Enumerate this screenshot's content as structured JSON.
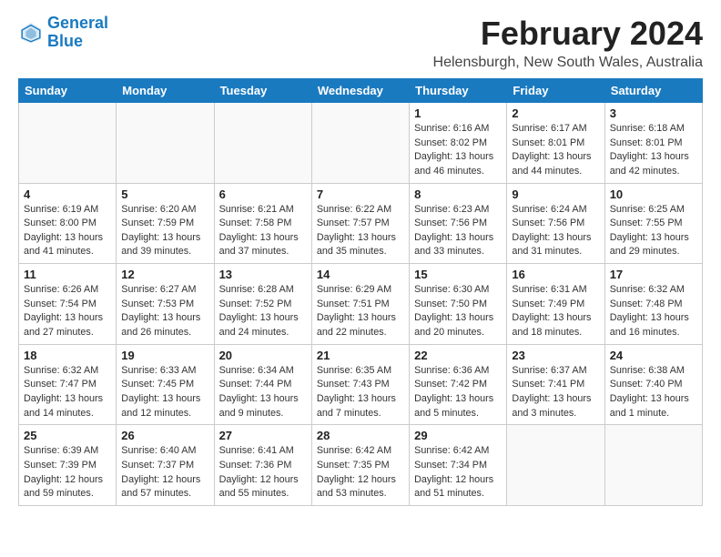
{
  "logo": {
    "text_general": "General",
    "text_blue": "Blue"
  },
  "title": "February 2024",
  "subtitle": "Helensburgh, New South Wales, Australia",
  "days_of_week": [
    "Sunday",
    "Monday",
    "Tuesday",
    "Wednesday",
    "Thursday",
    "Friday",
    "Saturday"
  ],
  "weeks": [
    [
      {
        "day": "",
        "info": ""
      },
      {
        "day": "",
        "info": ""
      },
      {
        "day": "",
        "info": ""
      },
      {
        "day": "",
        "info": ""
      },
      {
        "day": "1",
        "info": "Sunrise: 6:16 AM\nSunset: 8:02 PM\nDaylight: 13 hours\nand 46 minutes."
      },
      {
        "day": "2",
        "info": "Sunrise: 6:17 AM\nSunset: 8:01 PM\nDaylight: 13 hours\nand 44 minutes."
      },
      {
        "day": "3",
        "info": "Sunrise: 6:18 AM\nSunset: 8:01 PM\nDaylight: 13 hours\nand 42 minutes."
      }
    ],
    [
      {
        "day": "4",
        "info": "Sunrise: 6:19 AM\nSunset: 8:00 PM\nDaylight: 13 hours\nand 41 minutes."
      },
      {
        "day": "5",
        "info": "Sunrise: 6:20 AM\nSunset: 7:59 PM\nDaylight: 13 hours\nand 39 minutes."
      },
      {
        "day": "6",
        "info": "Sunrise: 6:21 AM\nSunset: 7:58 PM\nDaylight: 13 hours\nand 37 minutes."
      },
      {
        "day": "7",
        "info": "Sunrise: 6:22 AM\nSunset: 7:57 PM\nDaylight: 13 hours\nand 35 minutes."
      },
      {
        "day": "8",
        "info": "Sunrise: 6:23 AM\nSunset: 7:56 PM\nDaylight: 13 hours\nand 33 minutes."
      },
      {
        "day": "9",
        "info": "Sunrise: 6:24 AM\nSunset: 7:56 PM\nDaylight: 13 hours\nand 31 minutes."
      },
      {
        "day": "10",
        "info": "Sunrise: 6:25 AM\nSunset: 7:55 PM\nDaylight: 13 hours\nand 29 minutes."
      }
    ],
    [
      {
        "day": "11",
        "info": "Sunrise: 6:26 AM\nSunset: 7:54 PM\nDaylight: 13 hours\nand 27 minutes."
      },
      {
        "day": "12",
        "info": "Sunrise: 6:27 AM\nSunset: 7:53 PM\nDaylight: 13 hours\nand 26 minutes."
      },
      {
        "day": "13",
        "info": "Sunrise: 6:28 AM\nSunset: 7:52 PM\nDaylight: 13 hours\nand 24 minutes."
      },
      {
        "day": "14",
        "info": "Sunrise: 6:29 AM\nSunset: 7:51 PM\nDaylight: 13 hours\nand 22 minutes."
      },
      {
        "day": "15",
        "info": "Sunrise: 6:30 AM\nSunset: 7:50 PM\nDaylight: 13 hours\nand 20 minutes."
      },
      {
        "day": "16",
        "info": "Sunrise: 6:31 AM\nSunset: 7:49 PM\nDaylight: 13 hours\nand 18 minutes."
      },
      {
        "day": "17",
        "info": "Sunrise: 6:32 AM\nSunset: 7:48 PM\nDaylight: 13 hours\nand 16 minutes."
      }
    ],
    [
      {
        "day": "18",
        "info": "Sunrise: 6:32 AM\nSunset: 7:47 PM\nDaylight: 13 hours\nand 14 minutes."
      },
      {
        "day": "19",
        "info": "Sunrise: 6:33 AM\nSunset: 7:45 PM\nDaylight: 13 hours\nand 12 minutes."
      },
      {
        "day": "20",
        "info": "Sunrise: 6:34 AM\nSunset: 7:44 PM\nDaylight: 13 hours\nand 9 minutes."
      },
      {
        "day": "21",
        "info": "Sunrise: 6:35 AM\nSunset: 7:43 PM\nDaylight: 13 hours\nand 7 minutes."
      },
      {
        "day": "22",
        "info": "Sunrise: 6:36 AM\nSunset: 7:42 PM\nDaylight: 13 hours\nand 5 minutes."
      },
      {
        "day": "23",
        "info": "Sunrise: 6:37 AM\nSunset: 7:41 PM\nDaylight: 13 hours\nand 3 minutes."
      },
      {
        "day": "24",
        "info": "Sunrise: 6:38 AM\nSunset: 7:40 PM\nDaylight: 13 hours\nand 1 minute."
      }
    ],
    [
      {
        "day": "25",
        "info": "Sunrise: 6:39 AM\nSunset: 7:39 PM\nDaylight: 12 hours\nand 59 minutes."
      },
      {
        "day": "26",
        "info": "Sunrise: 6:40 AM\nSunset: 7:37 PM\nDaylight: 12 hours\nand 57 minutes."
      },
      {
        "day": "27",
        "info": "Sunrise: 6:41 AM\nSunset: 7:36 PM\nDaylight: 12 hours\nand 55 minutes."
      },
      {
        "day": "28",
        "info": "Sunrise: 6:42 AM\nSunset: 7:35 PM\nDaylight: 12 hours\nand 53 minutes."
      },
      {
        "day": "29",
        "info": "Sunrise: 6:42 AM\nSunset: 7:34 PM\nDaylight: 12 hours\nand 51 minutes."
      },
      {
        "day": "",
        "info": ""
      },
      {
        "day": "",
        "info": ""
      }
    ]
  ]
}
